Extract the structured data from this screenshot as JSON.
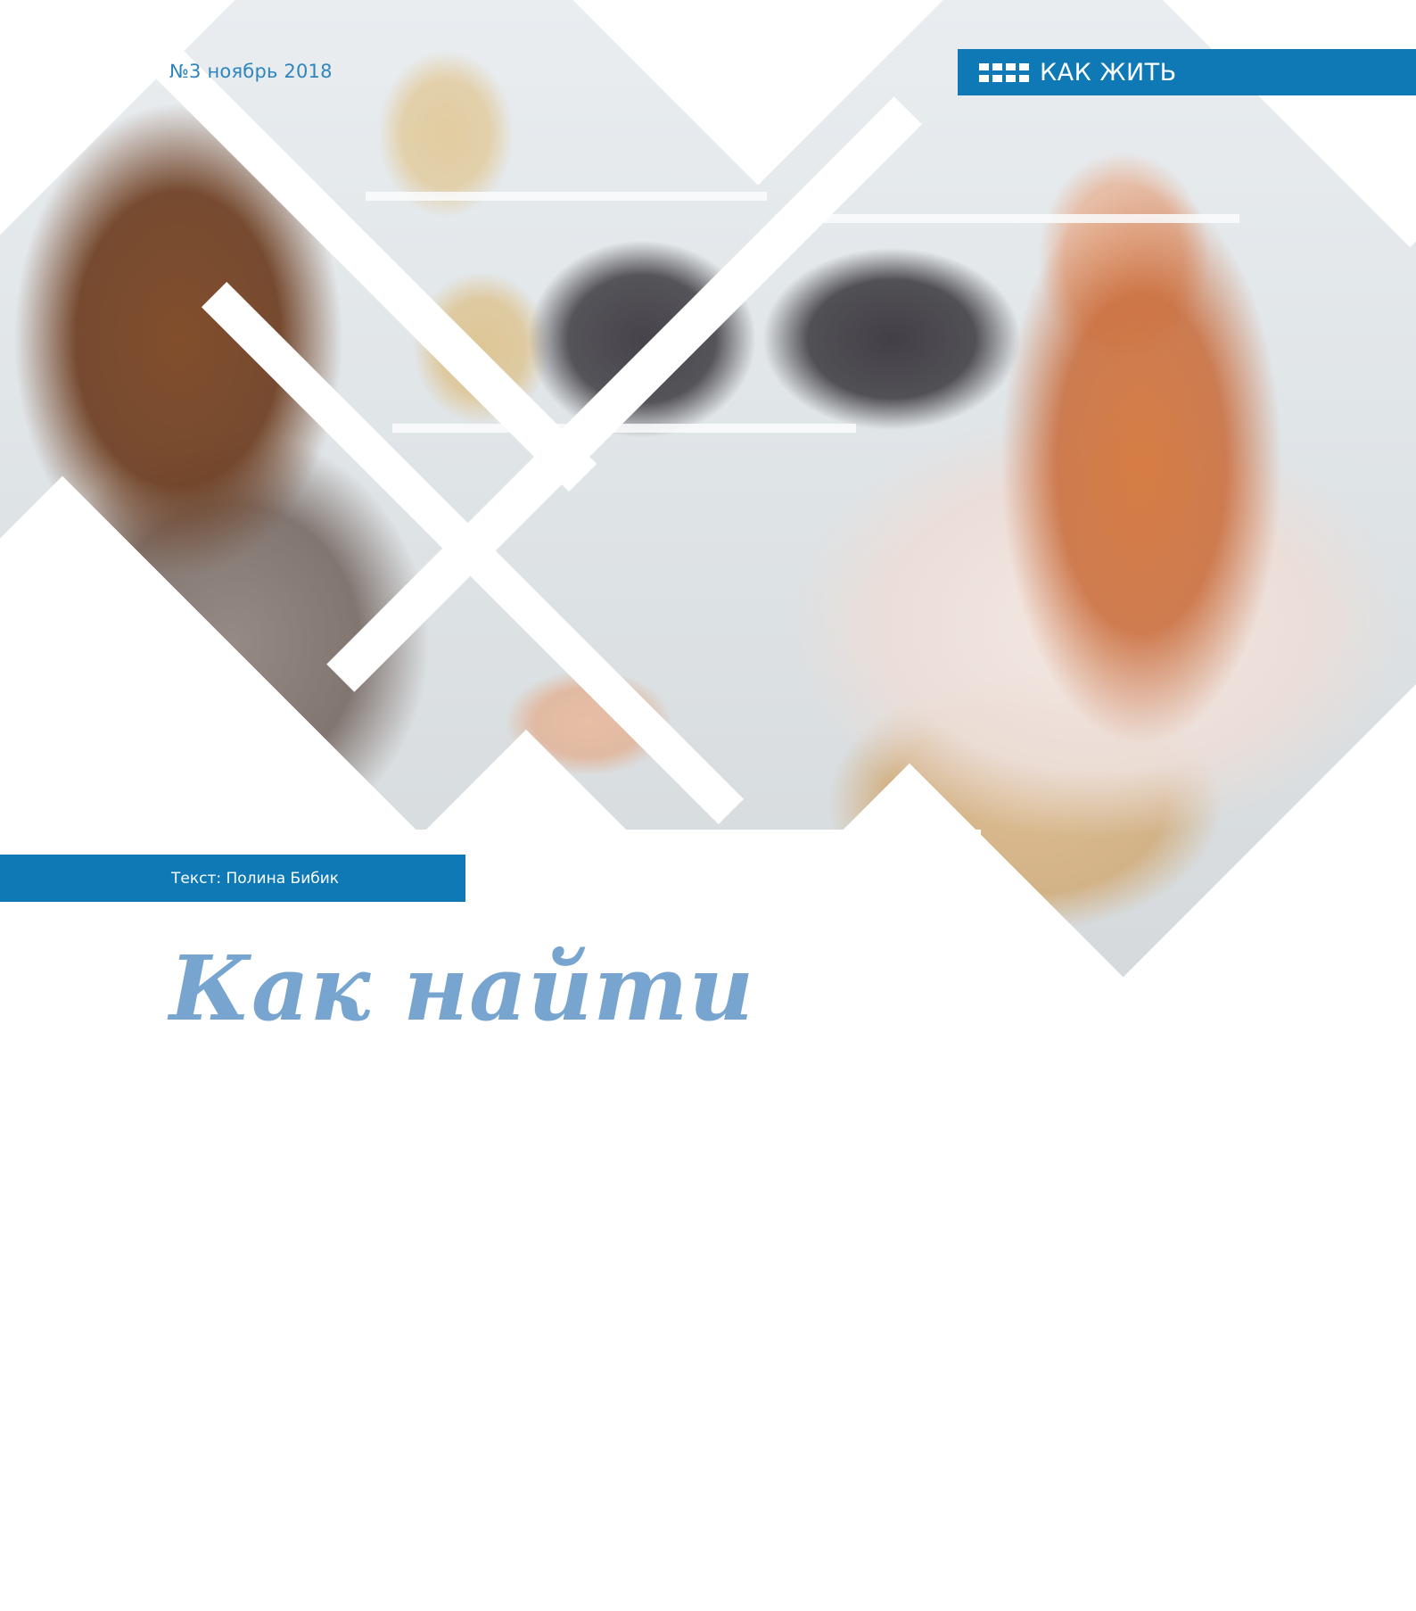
{
  "issue": {
    "label": "№3 ноябрь 2018"
  },
  "section": {
    "icon": "grid-icon",
    "label": "КАК ЖИТЬ"
  },
  "author": {
    "label": "Текст: Полина Бибик"
  },
  "headline": {
    "text": "Как найти"
  },
  "photo": {
    "description_icon": "photo-collage"
  },
  "colors": {
    "accent": "#0e79b5",
    "issue_text": "#2f86bf",
    "headline_text": "#77a5cf",
    "background": "#ffffff"
  }
}
